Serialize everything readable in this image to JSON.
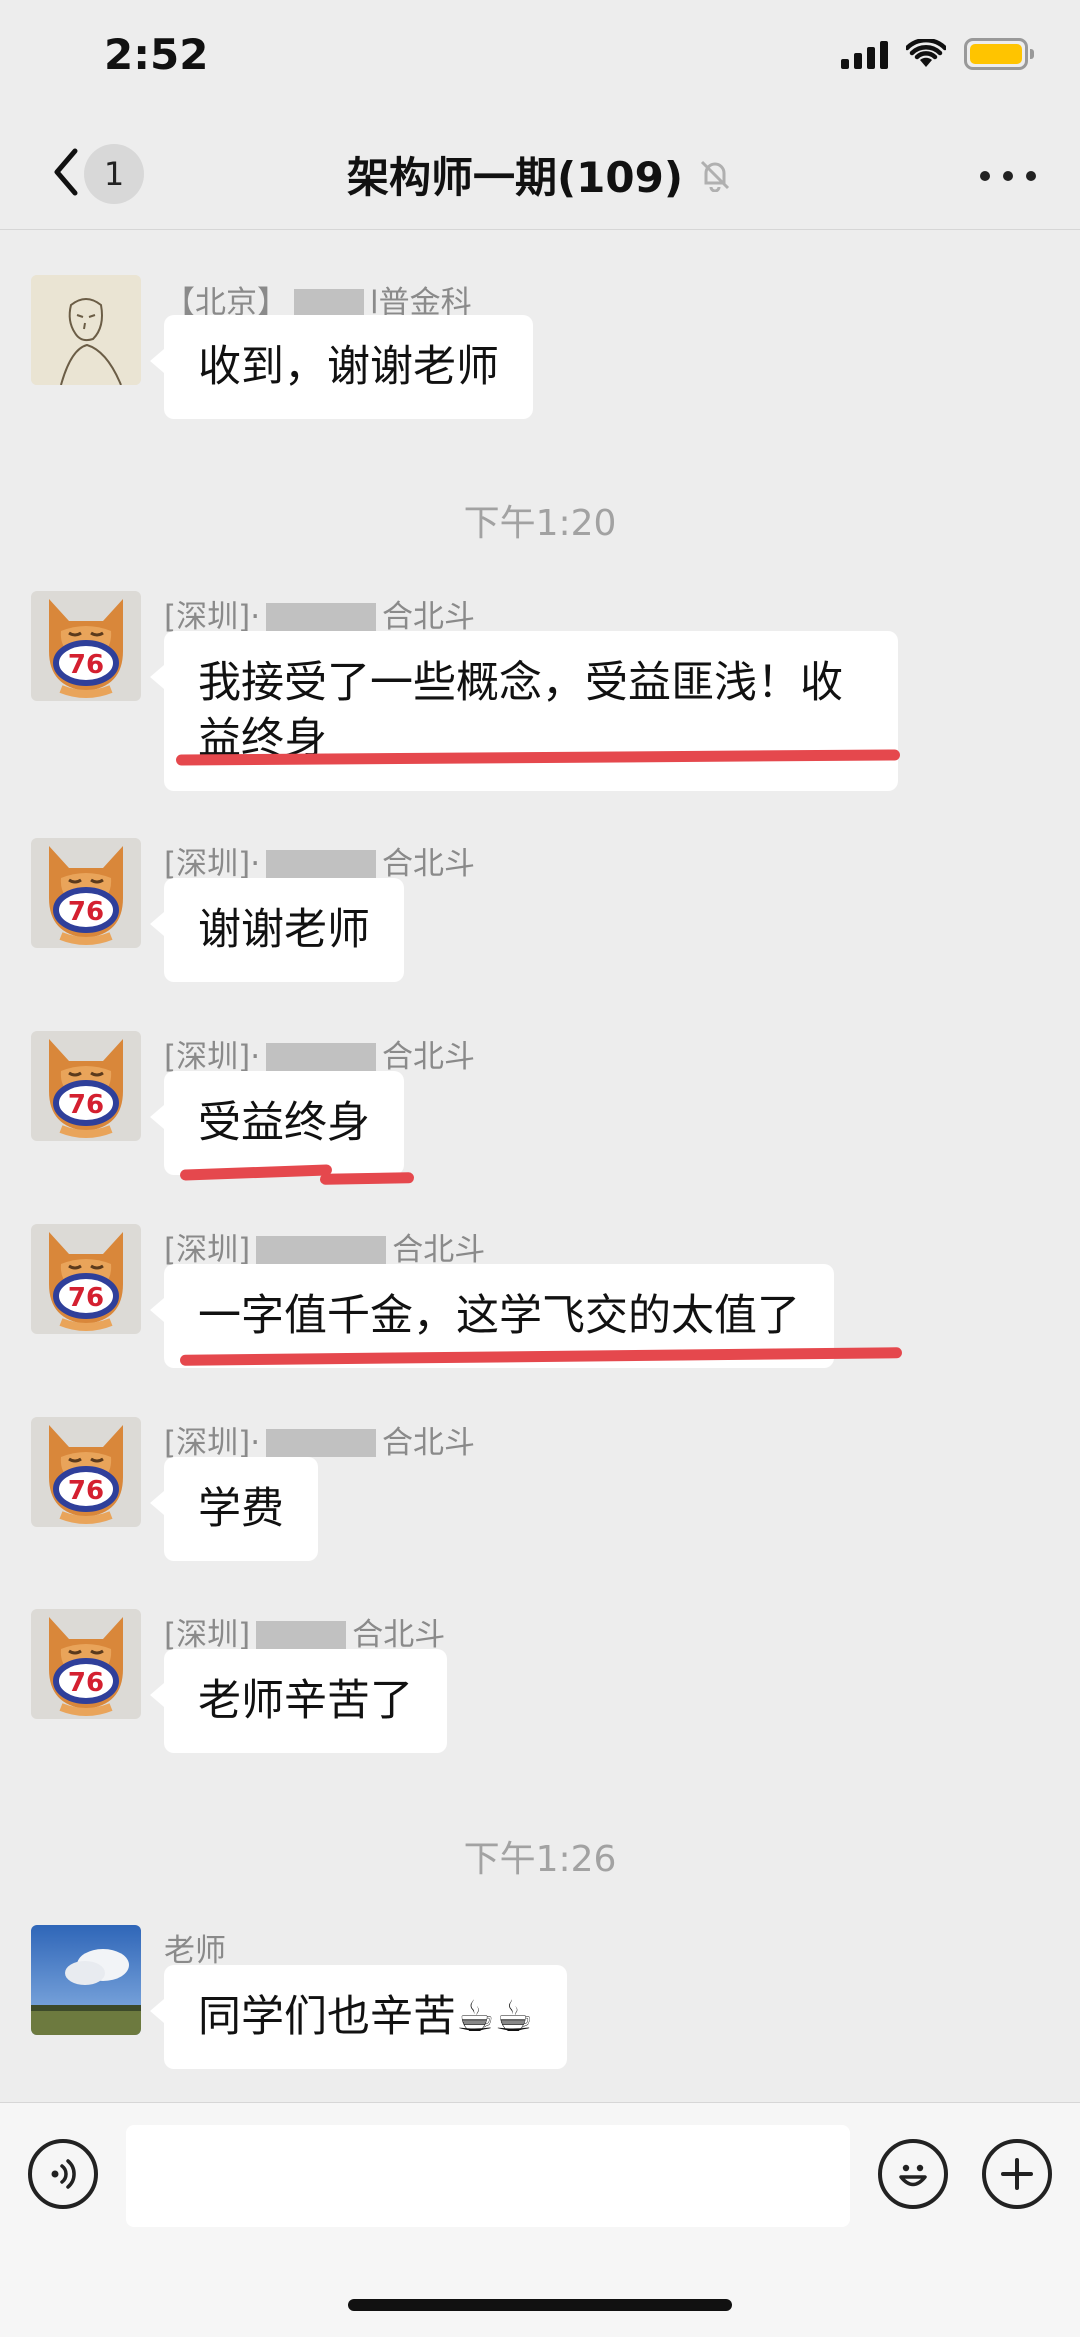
{
  "status_bar": {
    "time": "2:52",
    "signal_icon": "cellular-signal-icon",
    "wifi_icon": "wifi-icon",
    "battery_icon": "battery-icon",
    "battery_color": "#ffc400"
  },
  "nav": {
    "back_icon": "chevron-left-icon",
    "unread_count": "1",
    "title": "架构师一期(109)",
    "mute_icon": "bell-off-icon",
    "more_icon": "more-dots-icon"
  },
  "messages": [
    {
      "sender": "【北京】",
      "sender_suffix": "l普金科",
      "text": "收到，谢谢老师",
      "avatar": "sketch-portrait-avatar"
    },
    {
      "time": "下午1:20"
    },
    {
      "sender": "[深圳]·",
      "sender_suffix": "合北斗",
      "text": "我接受了一些概念，受益匪浅！收益终身",
      "avatar": "fox-76-avatar",
      "highlighted": true
    },
    {
      "sender": "[深圳]·",
      "sender_suffix": "合北斗",
      "text": "谢谢老师",
      "avatar": "fox-76-avatar"
    },
    {
      "sender": "[深圳]·",
      "sender_suffix": "合北斗",
      "text": "受益终身",
      "avatar": "fox-76-avatar",
      "highlighted": true
    },
    {
      "sender": "[深圳]",
      "sender_suffix": "合北斗",
      "text": "一字值千金，这学飞交的太值了",
      "avatar": "fox-76-avatar",
      "highlighted": true
    },
    {
      "sender": "[深圳]·",
      "sender_suffix": "合北斗",
      "text": "学费",
      "avatar": "fox-76-avatar"
    },
    {
      "sender": "[深圳]",
      "sender_suffix": "合北斗",
      "text": "老师辛苦了",
      "avatar": "fox-76-avatar"
    },
    {
      "time": "下午1:26"
    },
    {
      "sender": "老师",
      "text": "同学们也辛苦☕☕",
      "avatar": "sky-landscape-avatar"
    }
  ],
  "input_bar": {
    "voice_icon": "voice-input-icon",
    "input_value": "",
    "input_placeholder": "",
    "emoji_icon": "emoji-smile-icon",
    "plus_icon": "plus-circle-icon"
  },
  "colors": {
    "background": "#ededed",
    "bubble": "#ffffff",
    "highlight_red": "#e5484d",
    "meta_gray": "#8a8a8a"
  }
}
